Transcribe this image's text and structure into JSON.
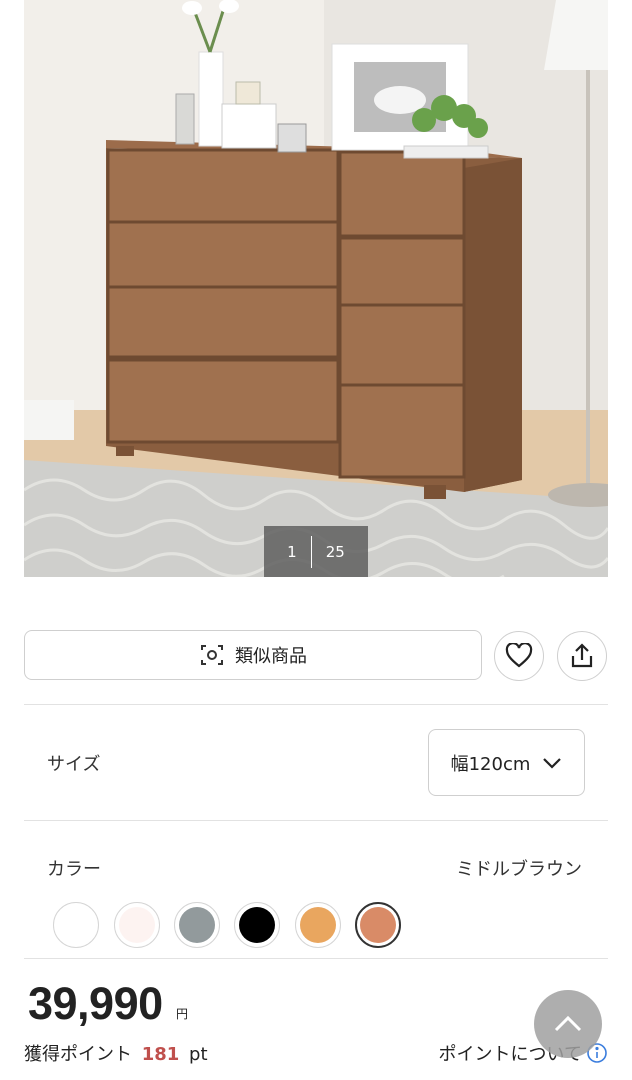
{
  "gallery": {
    "current_index": "1",
    "total_count": "25"
  },
  "actions": {
    "similar_label": "類似商品",
    "favorite_icon": "heart-icon",
    "share_icon": "share-icon"
  },
  "size": {
    "label": "サイズ",
    "selected": "幅120cm"
  },
  "color": {
    "label": "カラー",
    "selected_name": "ミドルブラウン",
    "swatches": [
      "#ffffff",
      "#fdf3f1",
      "#929a9c",
      "#000000",
      "#e9a65f",
      "#d98b67"
    ],
    "selected_index": 5
  },
  "price": {
    "amount": "39,990",
    "currency": "円"
  },
  "points": {
    "label": "獲得ポイント",
    "value": "181",
    "unit": "pt",
    "link_label": "ポイントについて",
    "accent": "#c0504d"
  }
}
